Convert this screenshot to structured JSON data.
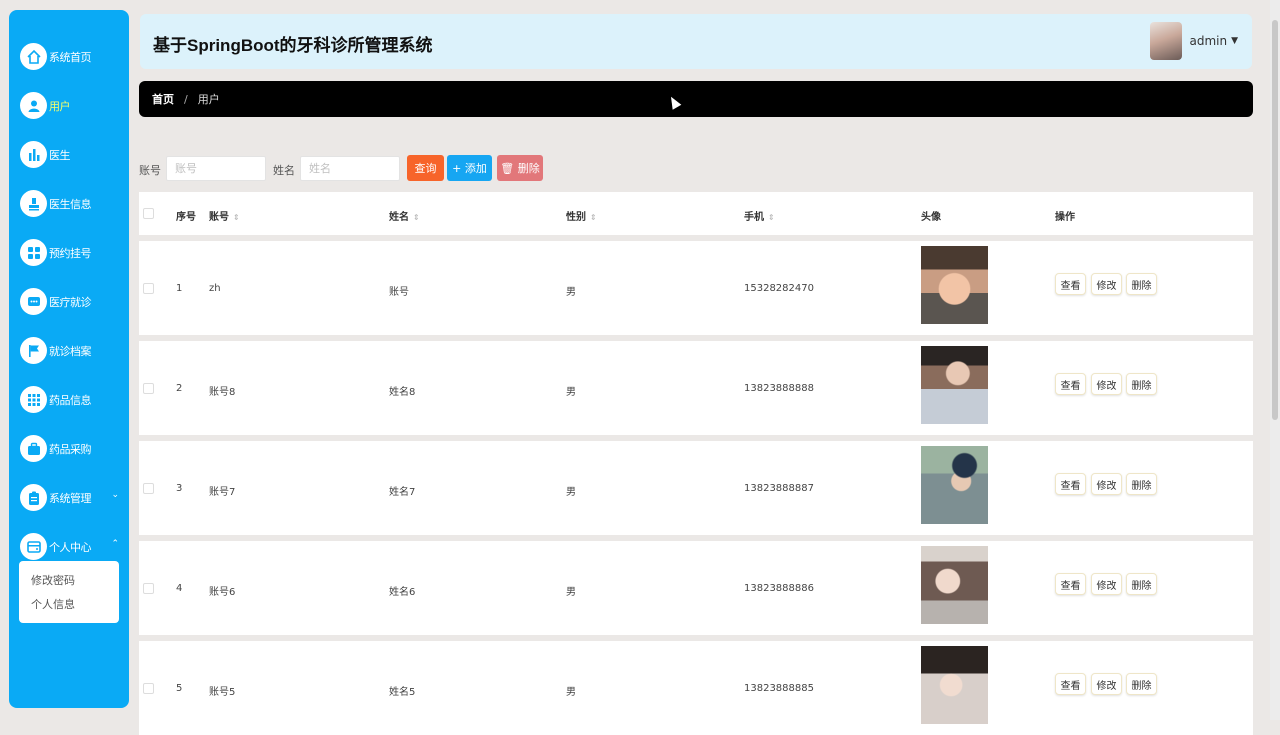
{
  "header": {
    "title": "基于SpringBoot的牙科诊所管理系统",
    "username": "admin"
  },
  "sidebar": {
    "items": [
      {
        "label": "系统首页",
        "icon": "home-icon"
      },
      {
        "label": "用户",
        "icon": "user-icon"
      },
      {
        "label": "医生",
        "icon": "bar-chart-icon"
      },
      {
        "label": "医生信息",
        "icon": "stamp-icon"
      },
      {
        "label": "预约挂号",
        "icon": "grid-icon"
      },
      {
        "label": "医疗就诊",
        "icon": "chat-icon"
      },
      {
        "label": "就诊档案",
        "icon": "flag-icon"
      },
      {
        "label": "药品信息",
        "icon": "apps-icon"
      },
      {
        "label": "药品采购",
        "icon": "briefcase-icon"
      },
      {
        "label": "系统管理",
        "icon": "clipboard-icon"
      },
      {
        "label": "个人中心",
        "icon": "wallet-icon"
      }
    ],
    "submenu": [
      "修改密码",
      "个人信息"
    ]
  },
  "breadcrumb": {
    "home": "首页",
    "separator": "/",
    "current": "用户"
  },
  "search": {
    "account_label": "账号",
    "account_placeholder": "账号",
    "name_label": "姓名",
    "name_placeholder": "姓名",
    "query_label": "查询",
    "add_label": "+ 添加",
    "delete_label": "🗑 删除"
  },
  "table": {
    "columns": [
      "序号",
      "账号",
      "姓名",
      "性别",
      "手机",
      "头像",
      "操作"
    ],
    "rows": [
      {
        "index": "1",
        "account": "zh",
        "name": "账号",
        "gender": "男",
        "phone": "15328282470"
      },
      {
        "index": "2",
        "account": "账号8",
        "name": "姓名8",
        "gender": "男",
        "phone": "13823888888"
      },
      {
        "index": "3",
        "account": "账号7",
        "name": "姓名7",
        "gender": "男",
        "phone": "13823888887"
      },
      {
        "index": "4",
        "account": "账号6",
        "name": "姓名6",
        "gender": "男",
        "phone": "13823888886"
      },
      {
        "index": "5",
        "account": "账号5",
        "name": "姓名5",
        "gender": "男",
        "phone": "13823888885"
      }
    ],
    "actions": {
      "view": "查看",
      "edit": "修改",
      "delete": "删除"
    }
  },
  "colors": {
    "sidebar": "#0aaaf5",
    "header": "#dcf2fb",
    "breadcrumb": "#000000",
    "query_button": "#f7642a",
    "add_button": "#16a6f2",
    "delete_button": "#e2777a",
    "active_menu": "#f6ff6a"
  }
}
